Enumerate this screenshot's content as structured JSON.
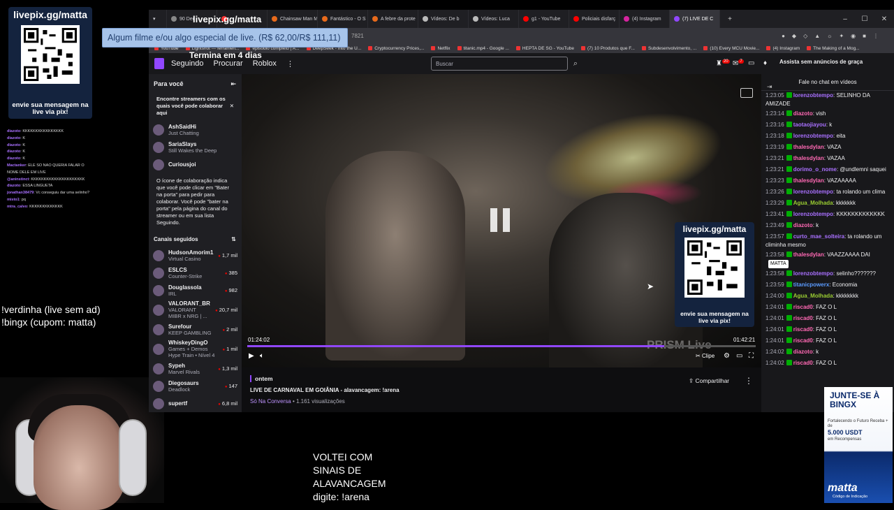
{
  "left_overlay": {
    "qr_title": "livepix.gg/matta",
    "qr_caption": "envie sua mensagem na live via pix!",
    "mini_chat": [
      {
        "user": "diazoto",
        "text": "KKKKKKKKKKKKKKKK"
      },
      {
        "user": "diazoto",
        "text": "K"
      },
      {
        "user": "diazoto",
        "text": "K"
      },
      {
        "user": "diazoto",
        "text": "K"
      },
      {
        "user": "diazoto",
        "text": "K"
      },
      {
        "user": "Mactanker",
        "text": "ELE SO NAO QUERIA FALAR O NOME DELE EM LIVE"
      },
      {
        "user": "@aninstinct",
        "text": "KKKKKKKKKKKKKKKKKKKKK"
      },
      {
        "user": "diazoto",
        "text": "ESSA LINGUETA"
      },
      {
        "user": "jonathan38479",
        "text": "Vc conseguiu dar uma selinho?"
      },
      {
        "user": "misto1",
        "text": "pq"
      },
      {
        "user": "mtra_calvo",
        "text": "KKKKKKKKKKKKK"
      }
    ],
    "commands": [
      "!verdinha (live sem ad)",
      "!bingx (cupom: matta)"
    ]
  },
  "overlays": {
    "livepix_header": "livepix.gg/matta",
    "donation": "Algum filme e/ou algo especial de live. (R$ 62,00/R$ 111,11)",
    "timer": "Termina em 4 dias",
    "bottom_text": [
      "VOLTEI COM",
      "SINAIS DE",
      "ALAVANCAGEM",
      "digite: !arena"
    ]
  },
  "browser": {
    "tabs": [
      {
        "label": "90 Dec",
        "color": "#888"
      },
      {
        "label": "",
        "color": "#f33"
      },
      {
        "label": "Chainsaw Man M",
        "color": "#e86a1b"
      },
      {
        "label": "Fantástico - O S",
        "color": "#e86a1b"
      },
      {
        "label": "A febre da prote",
        "color": "#e86a1b"
      },
      {
        "label": "Vídeos: De b",
        "color": "#bbb"
      },
      {
        "label": "Vídeos: Luca",
        "color": "#bbb"
      },
      {
        "label": "g1 - YouTube",
        "color": "#f00"
      },
      {
        "label": "Policiais disfarç",
        "color": "#f00"
      },
      {
        "label": "(4) Instagram",
        "color": "#d6249f"
      },
      {
        "label": "(7) LIVE DE C",
        "color": "#9147ff",
        "active": true
      }
    ],
    "address": "7821",
    "bookmarks": [
      "YouTube",
      "Lightshot — ferramen...",
      "episódio completo | A...",
      "DeepSeek - Into the U...",
      "Cryptocurrency Prices,...",
      "Netflix",
      "titanic.mp4 - Google ...",
      "HEPTA DE SG - YouTube",
      "(7) 10 Produtos que F...",
      "Subdesenvolvimento, ...",
      "(10) Every MCU Movie...",
      "(4) Instagram",
      "The Making of a Mog..."
    ]
  },
  "twitch": {
    "nav": [
      "Seguindo",
      "Procurar",
      "Roblox"
    ],
    "search_placeholder": "Buscar",
    "badge_notifications": "20",
    "badge_inbox": "7",
    "ad_free": "Assista sem anúncios de graça",
    "sidebar": {
      "for_you": "Para você",
      "collab_title": "Encontre streamers com os quais você pode colaborar aqui",
      "collab_streamers": [
        {
          "name": "AshSaidHi",
          "game": "Just Chatting"
        },
        {
          "name": "SariaSlays",
          "game": "Still Wakes the Deep"
        },
        {
          "name": "Curiousjoi",
          "game": ""
        }
      ],
      "collab_text": "O ícone de colaboração indica que você pode clicar em \"Bater na porta\" para pedir para colaborar. Você pode \"bater na porta\" pela página do canal do streamer ou em sua lista Seguindo.",
      "followed_title": "Canais seguidos",
      "followed": [
        {
          "name": "HudsonAmorim1",
          "game": "Virtual Casino",
          "viewers": "1,7 mil"
        },
        {
          "name": "ESLCS",
          "game": "Counter-Strike",
          "viewers": "385"
        },
        {
          "name": "Douglassola",
          "game": "IRL",
          "viewers": "982"
        },
        {
          "name": "VALORANT_BR",
          "game": "VALORANT",
          "extra": "MIBR x NRG | ...",
          "viewers": "20,7 mil"
        },
        {
          "name": "Surefour",
          "game": "KEEP GAMBLING",
          "viewers": "2 mil"
        },
        {
          "name": "WhiskeyDingO",
          "game": "Games + Demos",
          "extra": "Hype Train • Nível 4",
          "viewers": "1 mil"
        },
        {
          "name": "Sypeh",
          "game": "Marvel Rivals",
          "viewers": "1,3 mil"
        },
        {
          "name": "Diegosaurs",
          "game": "Deadlock",
          "viewers": "147"
        },
        {
          "name": "supertf",
          "game": "",
          "viewers": "6,8 mil"
        }
      ]
    },
    "video": {
      "time_current": "01:24:02",
      "time_total": "01:42:21",
      "progress": 0.82,
      "watermark": "PRISM Live",
      "clip": "Clipe",
      "qr_title": "livepix.gg/matta",
      "qr_caption": "envie sua mensagem na live via pix!"
    },
    "info": {
      "date": "ontem",
      "title": "LIVE DE CARNAVAL EM GOIÂNIA - alavancagem: !arena",
      "category": "Só Na Conversa",
      "views": "• 1.161 visualizações",
      "share": "Compartilhar"
    },
    "chat": {
      "header": "Fale no chat em vídeos",
      "messages": [
        {
          "ts": "1:23:05",
          "user": "lorenzobtempo",
          "color": "#a970ff",
          "text": ": SELINHO DA AMIZADE"
        },
        {
          "ts": "1:23:14",
          "user": "diazoto",
          "color": "#ff69b4",
          "text": ": vish"
        },
        {
          "ts": "1:23:16",
          "user": "taotaojiayou",
          "color": "#a970ff",
          "text": ": k"
        },
        {
          "ts": "1:23:18",
          "user": "lorenzobtempo",
          "color": "#a970ff",
          "text": ": eita"
        },
        {
          "ts": "1:23:19",
          "user": "thalesdylan",
          "color": "#ff69b4",
          "text": ": VAZA"
        },
        {
          "ts": "1:23:21",
          "user": "thalesdylan",
          "color": "#ff69b4",
          "text": ": VAZAA"
        },
        {
          "ts": "1:23:21",
          "user": "dorimo_o_nome",
          "color": "#a970ff",
          "text": ": @undlemni saquei"
        },
        {
          "ts": "1:23:23",
          "user": "thalesdylan",
          "color": "#ff69b4",
          "text": ": VAZAAAAA"
        },
        {
          "ts": "1:23:26",
          "user": "lorenzobtempo",
          "color": "#a970ff",
          "text": ": ta rolando um clima"
        },
        {
          "ts": "1:23:29",
          "user": "Agua_Molhada",
          "color": "#9acd32",
          "text": ": kkkkkkk"
        },
        {
          "ts": "1:23:41",
          "user": "lorenzobtempo",
          "color": "#a970ff",
          "text": ": KKKKKKKKKKKKK"
        },
        {
          "ts": "1:23:49",
          "user": "diazoto",
          "color": "#ff69b4",
          "text": ": k"
        },
        {
          "ts": "1:23:57",
          "user": "curto_mae_solteira",
          "color": "#a970ff",
          "text": ": ta rolando um climinha mesmo"
        },
        {
          "ts": "1:23:58",
          "user": "thalesdylan",
          "color": "#ff69b4",
          "text": ": VAAZZAAAA DAI",
          "tag": "MATTA"
        },
        {
          "ts": "1:23:58",
          "user": "lorenzobtempo",
          "color": "#a970ff",
          "text": ": selinho???????"
        },
        {
          "ts": "1:23:59",
          "user": "titanicpowerx",
          "color": "#5b9bff",
          "text": ": Economia"
        },
        {
          "ts": "1:24:00",
          "user": "Agua_Molhada",
          "color": "#9acd32",
          "text": ": kkkkkkkk"
        },
        {
          "ts": "1:24:01",
          "user": "riscad0",
          "color": "#ff69b4",
          "text": ": FAZ O L"
        },
        {
          "ts": "1:24:01",
          "user": "riscad0",
          "color": "#ff69b4",
          "text": ": FAZ O L"
        },
        {
          "ts": "1:24:01",
          "user": "riscad0",
          "color": "#ff69b4",
          "text": ": FAZ O L"
        },
        {
          "ts": "1:24:01",
          "user": "riscad0",
          "color": "#ff69b4",
          "text": ": FAZ O L"
        },
        {
          "ts": "1:24:02",
          "user": "diazoto",
          "color": "#ff69b4",
          "text": ": k"
        },
        {
          "ts": "1:24:02",
          "user": "riscad0",
          "color": "#ff69b4",
          "text": ": FAZ O L"
        }
      ]
    }
  },
  "bingx_ad": {
    "headline": "JUNTE-SE À BINGX",
    "sub": "Fortalecendo o Futuro Receba + de",
    "amount": "5.000 USDT",
    "amount_sub": "em Recompensas",
    "brand": "matta",
    "code_label": "Código de Indicação"
  }
}
